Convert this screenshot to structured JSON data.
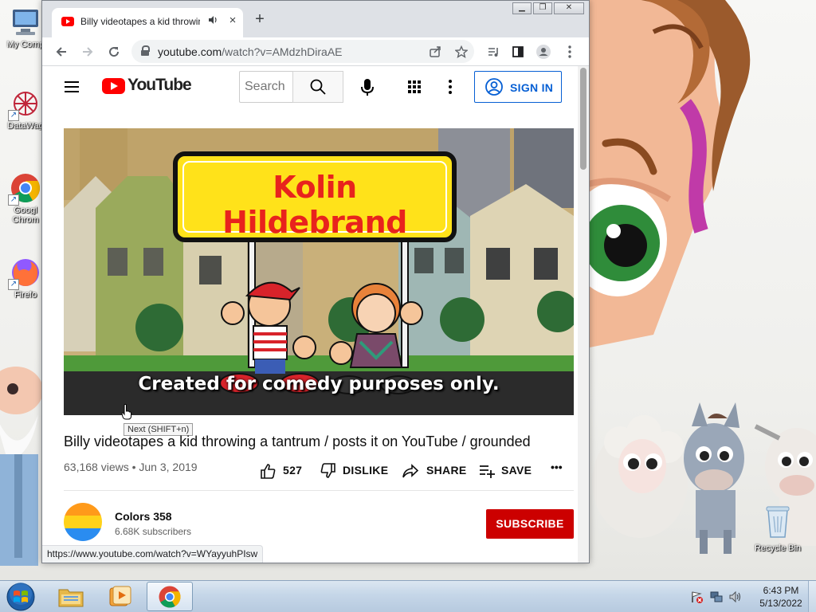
{
  "desktop": {
    "icons": [
      {
        "label": "My Comp"
      },
      {
        "label": "DataWag"
      },
      {
        "label": "Googl"
      },
      {
        "label": "Chrom"
      },
      {
        "label": "Firefo"
      }
    ],
    "recycle_bin": "Recycle Bin"
  },
  "browser": {
    "tab_title": "Billy videotapes a kid throwing a tantrum / posts it on YouTube / grounded",
    "new_tab_symbol": "+",
    "close_tab_symbol": "×",
    "url_host": "youtube.com",
    "url_path": "/watch?v=AMdzhDiraAE",
    "status_url": "https://www.youtube.com/watch?v=WYayyuhPIsw"
  },
  "youtube": {
    "logo_text": "YouTube",
    "search_placeholder": "Search",
    "sign_in": "SIGN IN",
    "video": {
      "banner_text": "Kolin Hildebrand",
      "caption": "Created for comedy purposes only.",
      "tooltip": "Next (SHIFT+n)",
      "title": "Billy videotapes a kid throwing a tantrum / posts it on YouTube / grounded",
      "meta": "63,168 views • Jun 3, 2019",
      "likes": "527",
      "dislike_label": "DISLIKE",
      "share_label": "SHARE",
      "save_label": "SAVE",
      "more_label": "•••"
    },
    "channel": {
      "name": "Colors 358",
      "subscribers": "6.68K subscribers",
      "subscribe_label": "SUBSCRIBE"
    }
  },
  "taskbar": {
    "time": "6:43 PM",
    "date": "5/13/2022"
  },
  "colors": {
    "youtube_red": "#ff0000",
    "subscribe_red": "#cc0000",
    "link_blue": "#065fd4",
    "banner_yellow": "#ffe21a",
    "banner_text_red": "#e8231d"
  }
}
